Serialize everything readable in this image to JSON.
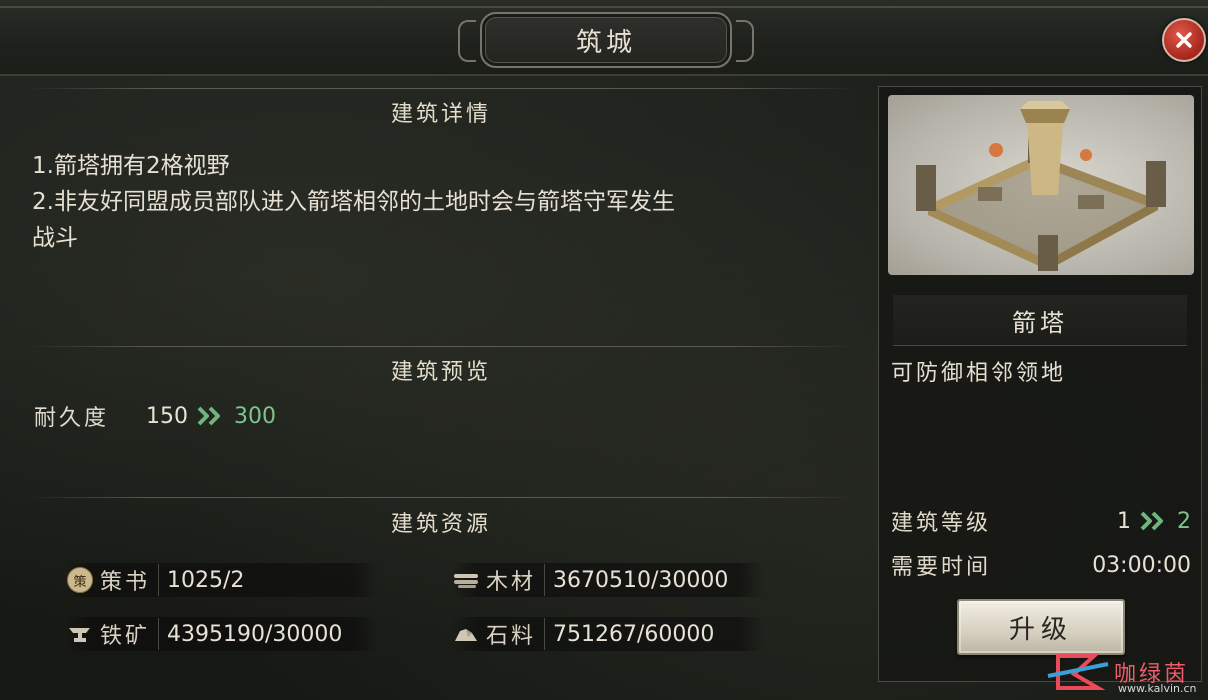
{
  "header": {
    "title": "筑城"
  },
  "details": {
    "heading": "建筑详情",
    "lines": [
      "1.箭塔拥有2格视野",
      "2.非友好同盟成员部队进入箭塔相邻的土地时会与箭塔守军发生",
      "战斗"
    ]
  },
  "preview": {
    "heading": "建筑预览",
    "durability_label": "耐久度",
    "durability_from": "150",
    "durability_to": "300"
  },
  "resources": {
    "heading": "建筑资源",
    "items": [
      {
        "icon": "strategy-book-icon",
        "badge": "策",
        "name": "策书",
        "value": "1025/2"
      },
      {
        "icon": "wood-icon",
        "name": "木材",
        "value": "3670510/30000"
      },
      {
        "icon": "iron-anvil-icon",
        "name": "铁矿",
        "value": "4395190/30000"
      },
      {
        "icon": "stone-icon",
        "name": "石料",
        "value": "751267/60000"
      }
    ]
  },
  "side": {
    "building_name": "箭塔",
    "description": "可防御相邻领地",
    "level_label": "建筑等级",
    "level_from": "1",
    "level_to": "2",
    "time_label": "需要时间",
    "time_value": "03:00:00",
    "upgrade_label": "升级"
  },
  "watermark": {
    "text": "咖绿茵",
    "url": "www.kalvin.cn"
  },
  "colors": {
    "accent_green": "#7fc48b",
    "close_red": "#c0392b"
  }
}
